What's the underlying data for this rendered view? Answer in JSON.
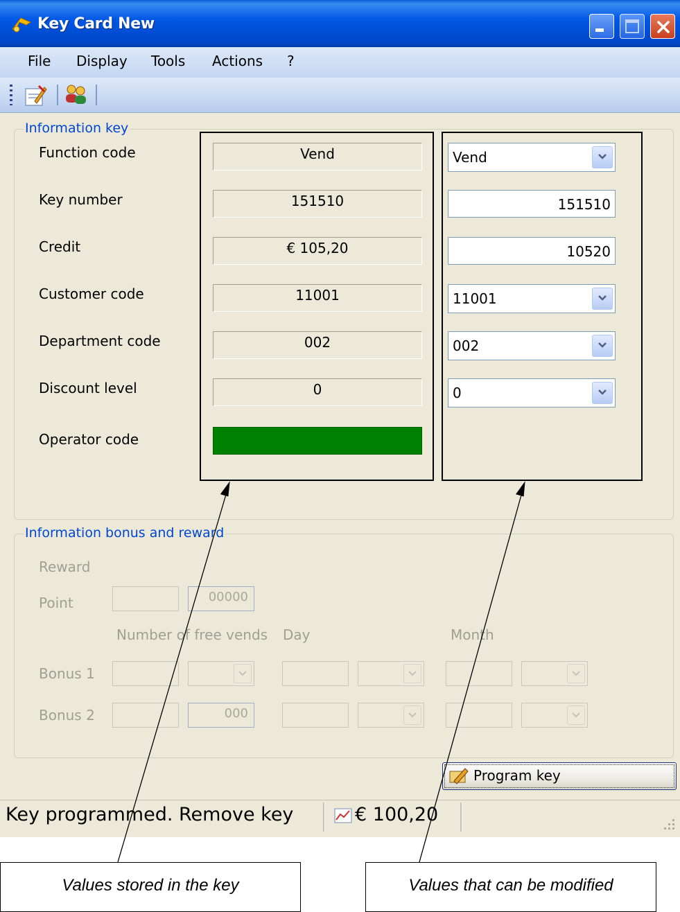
{
  "window": {
    "title": "Key Card New"
  },
  "menu": [
    "File",
    "Display",
    "Tools",
    "Actions",
    "?"
  ],
  "info_key": {
    "legend": "Information key",
    "rows": [
      {
        "label": "Function code",
        "stored": "Vend",
        "edit": "Vend",
        "edit_type": "combo"
      },
      {
        "label": "Key number",
        "stored": "151510",
        "edit": "151510",
        "edit_type": "text"
      },
      {
        "label": "Credit",
        "stored": "€ 105,20",
        "edit": "10520",
        "edit_type": "text"
      },
      {
        "label": "Customer code",
        "stored": "11001",
        "edit": "11001",
        "edit_type": "combo"
      },
      {
        "label": "Department code",
        "stored": "002",
        "edit": "002",
        "edit_type": "combo"
      },
      {
        "label": "Discount level",
        "stored": "0",
        "edit": "0",
        "edit_type": "combo"
      }
    ],
    "operator": {
      "label": "Operator code",
      "color": "#008000"
    }
  },
  "bonus": {
    "legend": "Information bonus and reward",
    "reward_label": "Reward",
    "point_label": "Point",
    "point_value": "00000",
    "col_headers": {
      "free_vends": "Number of free vends",
      "day": "Day",
      "month": "Month"
    },
    "bonus1_label": "Bonus 1",
    "bonus2_label": "Bonus 2",
    "bonus2_value": "000"
  },
  "program_button": "Program key",
  "status": {
    "message": "Key programmed. Remove key",
    "amount": "€ 100,20"
  },
  "annotations": {
    "stored": "Values stored in the key",
    "modified": "Values that can be modified"
  },
  "colors": {
    "titlebar": "#0058e6",
    "legend_text": "#0046d5",
    "operator_fill": "#008000"
  }
}
